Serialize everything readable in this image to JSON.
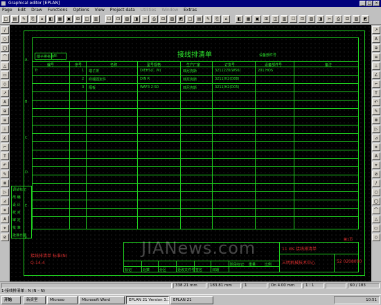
{
  "window": {
    "title": "Graphical editor [EPLAN]"
  },
  "menu": [
    "Page",
    "Edit",
    "Draw",
    "Functions",
    "Options",
    "View",
    "Project data",
    "Utilities",
    "Window",
    "Extras"
  ],
  "menu_dimmed": [
    7,
    8
  ],
  "drawing": {
    "title": "接线排清单",
    "header_label": "端子排名称",
    "header_value": "N",
    "top_right_label": "设备部件号",
    "columns": [
      "编号",
      "序号",
      "名称",
      "型号规格",
      "生产厂家",
      "订货号",
      "设备部件号",
      "备注"
    ],
    "rows": [
      {
        "c1": "Tr",
        "c2": "1",
        "c3": "端子排",
        "c4": "DIEHS(C..M)",
        "c5": "菲尼克斯",
        "c6": "3211220(W56)",
        "c7": "201.HOS",
        "c8": ""
      },
      {
        "c1": "",
        "c2": "2",
        "c3": "终端固定件",
        "c4": "DIN R",
        "c5": "菲尼克斯",
        "c6": "3211/H2(D88)",
        "c7": "",
        "c8": ""
      },
      {
        "c1": "",
        "c2": "3",
        "c3": "隔板",
        "c4": "WAF3 2-S0",
        "c5": "菲尼克斯",
        "c6": "3211/H2(D05)",
        "c7": "",
        "c8": ""
      }
    ],
    "row_letters": [
      "A",
      "B",
      "C",
      "D",
      "E",
      "F"
    ],
    "left_labels": [
      "调试标记",
      "改  编",
      "设  计",
      "校  对",
      "审  定",
      "批  准",
      "批准日期"
    ],
    "title_block": {
      "note_red": "接线排清单 标准(N)",
      "code_red": "Q-14-4",
      "top_right_red": "11 ids 接线排清单",
      "company_red": "三明机械技术中心",
      "sheet_no": "52 0208000",
      "page_red": "第1页",
      "col_labels": [
        "标记",
        "处数",
        "分区",
        "更改文件号",
        "签名",
        "日期",
        "",
        "阶段标记",
        "重量",
        "比例"
      ]
    }
  },
  "watermark": "JIANews.com",
  "status": {
    "fields": [
      "",
      "338.21 mm",
      "183.81 mm",
      "1",
      "On 4.00 mm",
      "1 : 1",
      "",
      "60 / 183"
    ],
    "line": "1-接线排清单 : N  (N – N)"
  },
  "taskbar": {
    "start": "开始",
    "tasks": [
      "新资室",
      "Microso",
      "Microsoft Word",
      "EPLAN 21 Version 3.2",
      "EPLAN 21"
    ],
    "active": 3,
    "clock": "10:51"
  },
  "colors": {
    "line": "#1fd11f",
    "text": "#2ee82e",
    "red": "#e03030",
    "canvas": "#000000"
  }
}
